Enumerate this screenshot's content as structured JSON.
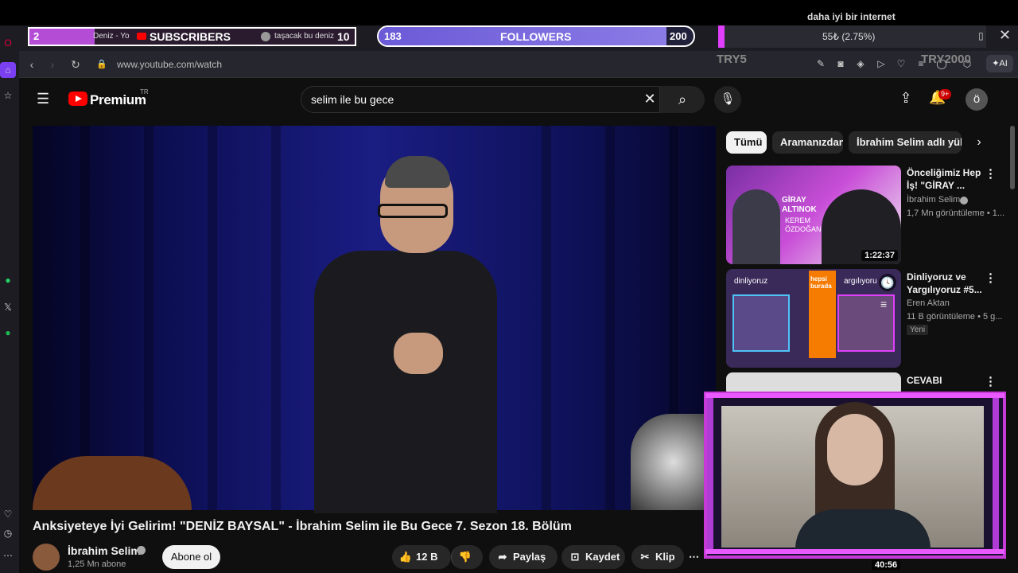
{
  "stream_overlay": {
    "caption": "daha iyi bir internet",
    "subscribers": {
      "count": "2",
      "label": "SUBSCRIBERS",
      "goal": "10",
      "progress": 0.2
    },
    "followers": {
      "count": "183",
      "label": "FOLLOWERS",
      "goal": "200",
      "progress": 0.915
    },
    "mini_tabs": [
      "Deniz - Yo",
      "taşacak bu deniz"
    ],
    "tab_percent": "55₺ (2.75%)",
    "try_left": "TRY5",
    "try_right": "TRY2000"
  },
  "browser": {
    "url": "www.youtube.com/watch",
    "ai_label": "AI"
  },
  "youtube": {
    "brand": "Premium",
    "region": "TR",
    "search_query": "selim ile bu gece",
    "notification_count": "9+",
    "avatar_letter": "ö"
  },
  "video": {
    "title": "Anksiyeteye İyi Gelirim! \"DENİZ BAYSAL\" - İbrahim Selim ile Bu Gece 7. Sezon 18. Bölüm",
    "channel": "İbrahim Selim",
    "subscribers": "1,25 Mn abone",
    "subscribe_label": "Abone ol",
    "likes": "12 B",
    "share_label": "Paylaş",
    "save_label": "Kaydet",
    "clip_label": "Klip"
  },
  "chips": [
    "Tümü",
    "Aramanızdan",
    "İbrahim Selim adlı yükleyic"
  ],
  "recommendations": [
    {
      "title": "Önceliğimiz Hep İş! \"GİRAY ...",
      "channel": "İbrahim Selim",
      "meta": "1,7 Mn görüntüleme • 1...",
      "duration": "1:22:37",
      "thumb_text": [
        "GİRAY",
        "ALTINOK",
        "KEREM",
        "ÖZDOĞAN"
      ]
    },
    {
      "title": "Dinliyoruz ve Yargılıyoruz #5...",
      "channel": "Eren Aktan",
      "meta": "11 B görüntüleme • 5 g...",
      "badge": "Yeni",
      "thumb_text": [
        "dinliyoruz",
        "hepsi burada",
        "argılıyoru"
      ]
    },
    {
      "title": "CEVABI",
      "duration": "40:56"
    }
  ],
  "colors": {
    "yt_red": "#ff0000",
    "overlay_purple": "#b44cd6",
    "follower_bar": "#7b6ae0",
    "cam_border": "#e85aff"
  }
}
